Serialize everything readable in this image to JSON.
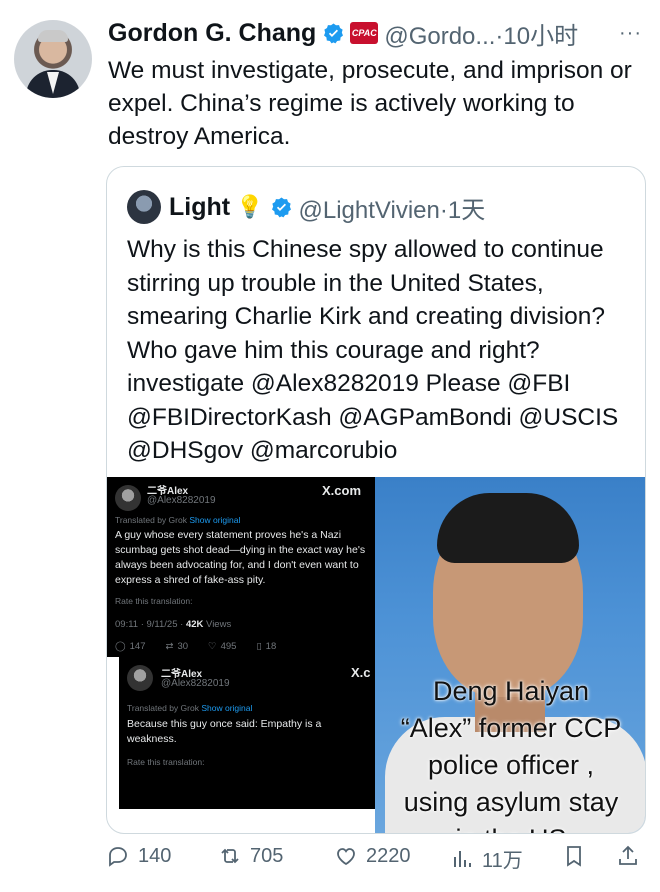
{
  "author": {
    "display_name": "Gordon G. Chang",
    "badge_text": "CPAC",
    "handle": "@Gordo...",
    "separator": "·",
    "time": "10小时",
    "more": "···"
  },
  "tweet_text": "We must investigate, prosecute, and imprison or expel. China’s regime is actively working to destroy America.",
  "quote": {
    "display_name": "Light",
    "handle": "@LightVivien",
    "separator": "·",
    "time": "1天",
    "text": "Why is this Chinese spy  allowed to continue stirring up trouble in the United States, smearing Charlie Kirk and creating division? Who gave him this courage and right? investigate @Alex8282019 Please @FBI @FBIDirectorKash @AGPamBondi @USCIS @DHSgov @marcorubio",
    "screenshot1": {
      "name": "二爷Alex",
      "handle": "@Alex8282019",
      "xcom": "X.com",
      "translated_by": "Translated by Grok",
      "show_original": "Show original",
      "body": "A guy whose every statement proves he's a Nazi scumbag gets shot dead—dying in the exact way he's always been advocating for, and I don't even want to express a shred of fake-ass pity.",
      "rate": "Rate this translation:",
      "meta_time": "09:11 · 9/11/25 · ",
      "meta_views": "42K",
      "meta_views_label": " Views",
      "stats": {
        "replies": "147",
        "reposts": "30",
        "likes": "495",
        "bookmarks": "18"
      }
    },
    "screenshot2": {
      "name": "二爷Alex",
      "handle": "@Alex8282019",
      "xcom": "X.c",
      "translated_by": "Translated by Grok",
      "show_original": "Show original",
      "body": "Because this guy once said: Empathy is a weakness.",
      "rate": "Rate this translation:"
    },
    "photo_caption": [
      "Deng Haiyan",
      "“Alex” former CCP",
      "police officer ,",
      "using asylum stay",
      "in the US"
    ]
  },
  "actions": {
    "replies": "140",
    "reposts": "705",
    "likes": "2220",
    "views": "11万"
  },
  "colors": {
    "verified_blue": "#1d9bf0",
    "secondary_text": "#536471",
    "cpac_red": "#c8102e"
  },
  "icons": [
    "verified-badge-icon",
    "lightbulb-icon",
    "reply-icon",
    "repost-icon",
    "like-icon",
    "views-icon",
    "bookmark-icon",
    "share-icon",
    "more-icon"
  ]
}
